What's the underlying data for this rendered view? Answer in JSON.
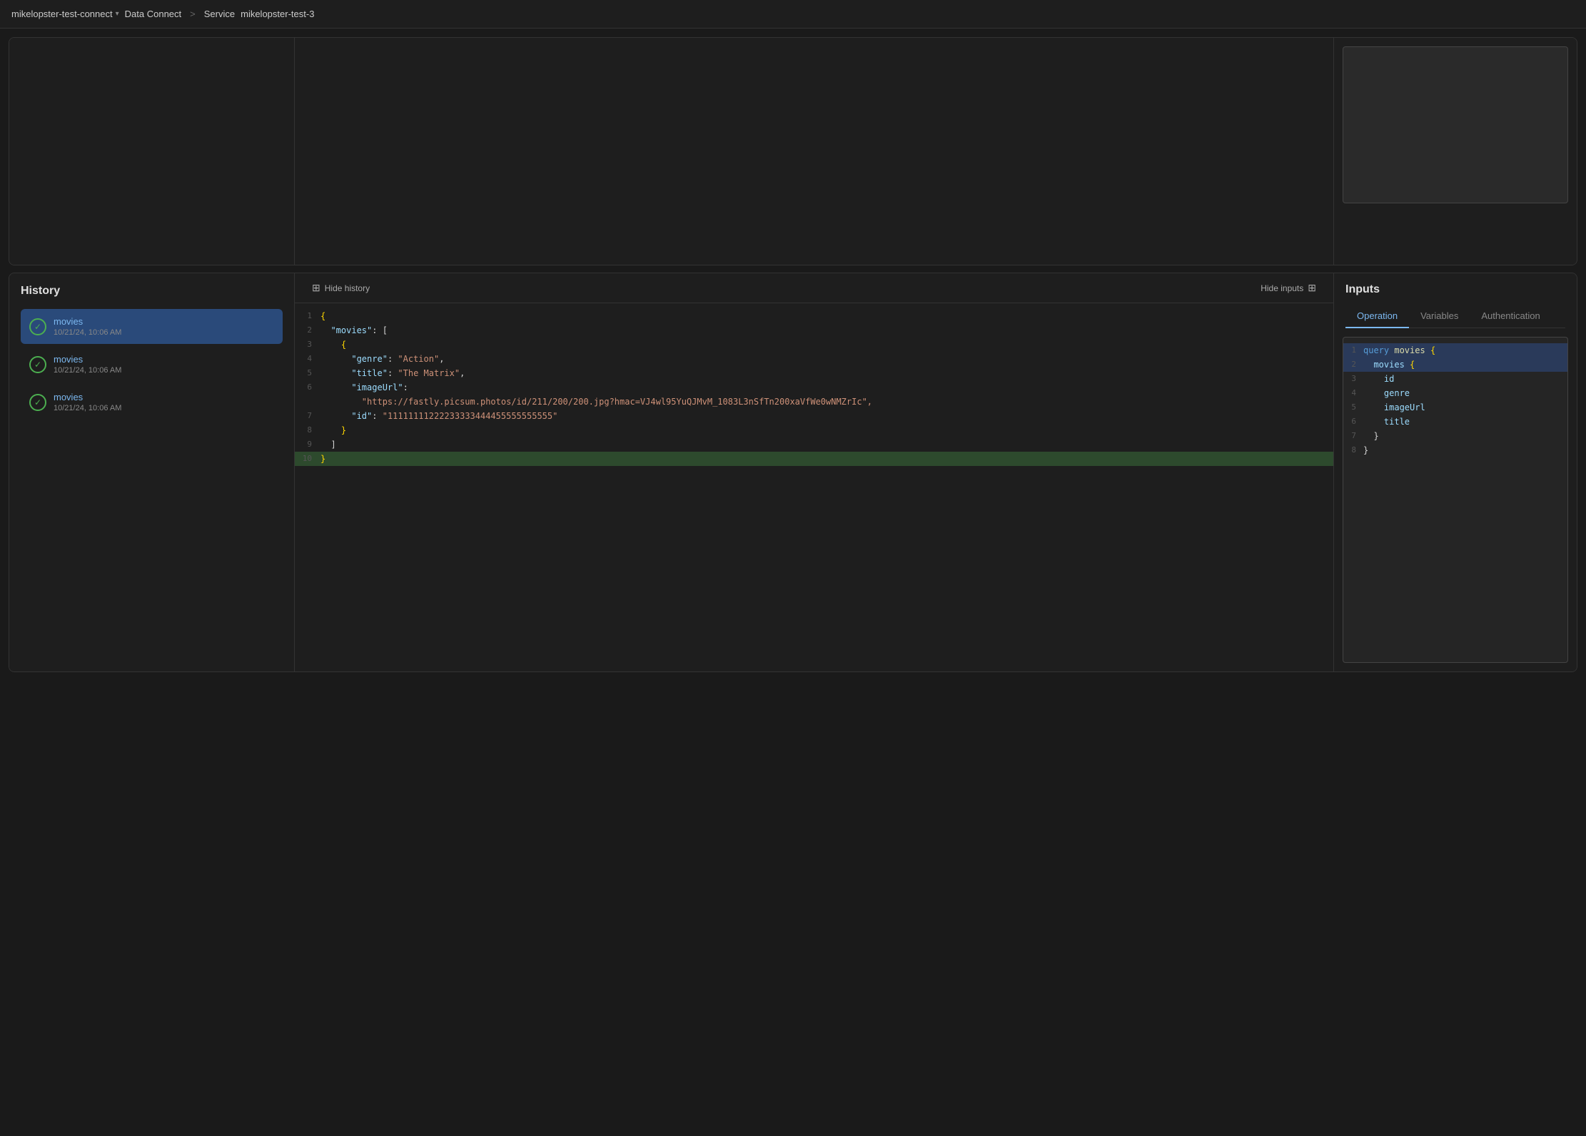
{
  "topbar": {
    "project": "mikelopster-test-connect",
    "chevron": "▾",
    "breadcrumb1": "Data Connect",
    "separator1": ">",
    "breadcrumb2": "Service",
    "service_name": "mikelopster-test-3"
  },
  "history": {
    "title": "History",
    "items": [
      {
        "name": "movies",
        "time": "10/21/24, 10:06 AM",
        "active": true
      },
      {
        "name": "movies",
        "time": "10/21/24, 10:06 AM",
        "active": false
      },
      {
        "name": "movies",
        "time": "10/21/24, 10:06 AM",
        "active": false
      }
    ]
  },
  "code_panel": {
    "hide_history_label": "Hide history",
    "hide_inputs_label": "Hide inputs",
    "lines": [
      {
        "num": "1",
        "content": "{",
        "highlighted": false
      },
      {
        "num": "2",
        "content": "  \"movies\": [",
        "highlighted": false
      },
      {
        "num": "3",
        "content": "    {",
        "highlighted": false
      },
      {
        "num": "4",
        "content": "      \"genre\": \"Action\",",
        "highlighted": false
      },
      {
        "num": "5",
        "content": "      \"title\": \"The Matrix\",",
        "highlighted": false
      },
      {
        "num": "6",
        "content": "      \"imageUrl\":",
        "highlighted": false
      },
      {
        "num": "6b",
        "content": "\"https://fastly.picsum.photos/id/211/200/200.jpg?hmac=VJ4wl95YuQJMvM_1083L3nSfTn200xaVfWe0wNMZrIc\",",
        "highlighted": false
      },
      {
        "num": "7",
        "content": "      \"id\": \"11111111222233333444455555555555\"",
        "highlighted": false
      },
      {
        "num": "8",
        "content": "    }",
        "highlighted": false
      },
      {
        "num": "9",
        "content": "  ]",
        "highlighted": false
      },
      {
        "num": "10",
        "content": "}",
        "highlighted": true
      }
    ]
  },
  "inputs": {
    "title": "Inputs",
    "tabs": [
      {
        "label": "Operation",
        "active": true
      },
      {
        "label": "Variables",
        "active": false
      },
      {
        "label": "Authentication",
        "active": false
      }
    ],
    "query_lines": [
      {
        "num": "1",
        "content": "query movies {",
        "highlighted": true
      },
      {
        "num": "2",
        "content": "  movies {",
        "highlighted": true
      },
      {
        "num": "3",
        "content": "    id",
        "highlighted": false
      },
      {
        "num": "4",
        "content": "    genre",
        "highlighted": false
      },
      {
        "num": "5",
        "content": "    imageUrl",
        "highlighted": false
      },
      {
        "num": "6",
        "content": "    title",
        "highlighted": false
      },
      {
        "num": "7",
        "content": "  }",
        "highlighted": false
      },
      {
        "num": "8",
        "content": "}",
        "highlighted": false
      }
    ]
  }
}
